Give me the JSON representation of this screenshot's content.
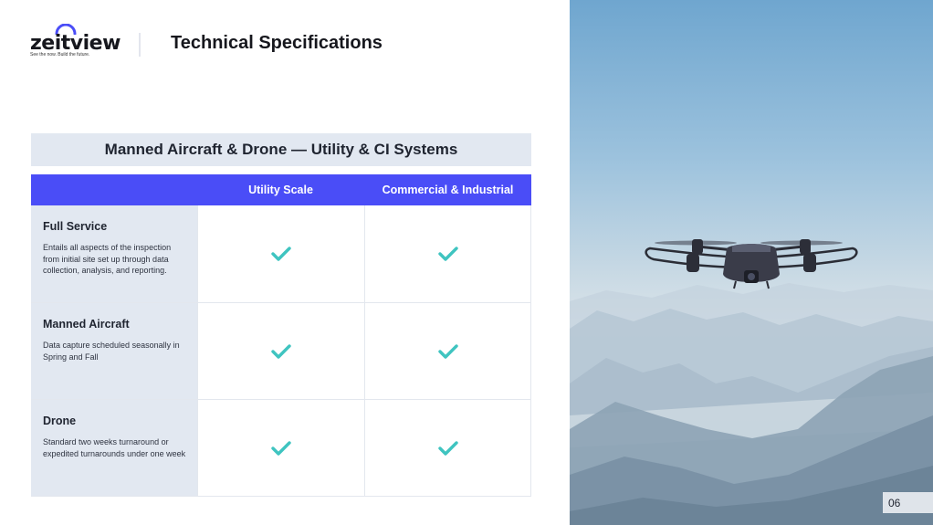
{
  "brand": {
    "name": "zeitview",
    "tagline": "See the now. Build the future.",
    "accent": "#4a4df7"
  },
  "header": {
    "title": "Technical Specifications"
  },
  "table": {
    "title": "Manned Aircraft & Drone — Utility & CI Systems",
    "columns": [
      "",
      "Utility Scale",
      "Commercial & Industrial"
    ],
    "rows": [
      {
        "title": "Full Service",
        "description": "Entails all aspects of the inspection from initial site set up through data collection, analysis, and reporting.",
        "utility_scale": "check-icon",
        "commercial_industrial": "check-icon"
      },
      {
        "title": "Manned Aircraft",
        "description": "Data capture scheduled seasonally in Spring and Fall",
        "utility_scale": "check-icon",
        "commercial_industrial": "check-icon"
      },
      {
        "title": "Drone",
        "description": "Standard two weeks turnaround or expedited turnarounds under one week",
        "utility_scale": "check-icon",
        "commercial_industrial": "check-icon"
      }
    ],
    "header_color": "#4a4df7",
    "label_bg": "#e2e8f1",
    "check_color": "#3fc4c0"
  },
  "footer": {
    "page_number": "06"
  }
}
